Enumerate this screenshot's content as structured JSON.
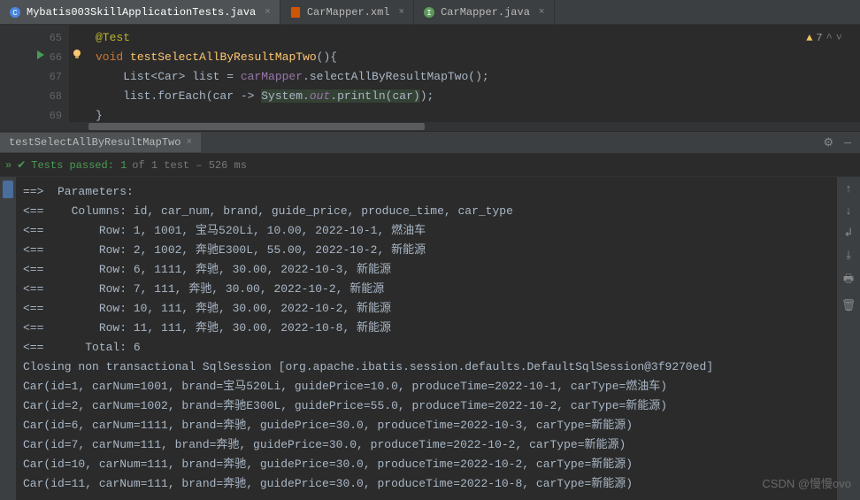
{
  "tabs": [
    {
      "label": "Mybatis003SkillApplicationTests.java",
      "iconColor": "#4a86e8",
      "active": true
    },
    {
      "label": "CarMapper.xml",
      "iconColor": "#d35400",
      "active": false
    },
    {
      "label": "CarMapper.java",
      "iconColor": "#4a86e8",
      "active": false
    }
  ],
  "warnings": {
    "count": "7"
  },
  "gutter": [
    "65",
    "66",
    "67",
    "68",
    "69"
  ],
  "code": {
    "l65": {
      "annotation": "@Test"
    },
    "l66": {
      "kw": "void",
      "method": "testSelectAllByResultMapTwo",
      "tail": "(){"
    },
    "l67": {
      "pre": "    List<Car> list = ",
      "field": "carMapper",
      "post": ".selectAllByResultMapTwo();"
    },
    "l68": {
      "pre": "    list.forEach(car -> ",
      "cls": "System",
      "dot1": ".",
      "out": "out",
      "dot2": ".",
      "m2": "println(car)",
      "post": ");"
    },
    "l69": {
      "brace": "}"
    }
  },
  "runTab": {
    "label": "testSelectAllByResultMapTwo"
  },
  "testStatus": {
    "passed": "Tests passed: 1",
    "info": " of 1 test – 526 ms"
  },
  "console": [
    "==>  Parameters: ",
    "<==    Columns: id, car_num, brand, guide_price, produce_time, car_type",
    "<==        Row: 1, 1001, 宝马520Li, 10.00, 2022-10-1, 燃油车",
    "<==        Row: 2, 1002, 奔驰E300L, 55.00, 2022-10-2, 新能源",
    "<==        Row: 6, 1111, 奔驰, 30.00, 2022-10-3, 新能源",
    "<==        Row: 7, 111, 奔驰, 30.00, 2022-10-2, 新能源",
    "<==        Row: 10, 111, 奔驰, 30.00, 2022-10-2, 新能源",
    "<==        Row: 11, 111, 奔驰, 30.00, 2022-10-8, 新能源",
    "<==      Total: 6",
    "Closing non transactional SqlSession [org.apache.ibatis.session.defaults.DefaultSqlSession@3f9270ed]",
    "Car(id=1, carNum=1001, brand=宝马520Li, guidePrice=10.0, produceTime=2022-10-1, carType=燃油车)",
    "Car(id=2, carNum=1002, brand=奔驰E300L, guidePrice=55.0, produceTime=2022-10-2, carType=新能源)",
    "Car(id=6, carNum=1111, brand=奔驰, guidePrice=30.0, produceTime=2022-10-3, carType=新能源)",
    "Car(id=7, carNum=111, brand=奔驰, guidePrice=30.0, produceTime=2022-10-2, carType=新能源)",
    "Car(id=10, carNum=111, brand=奔驰, guidePrice=30.0, produceTime=2022-10-2, carType=新能源)",
    "Car(id=11, carNum=111, brand=奔驰, guidePrice=30.0, produceTime=2022-10-8, carType=新能源)"
  ],
  "watermark": "CSDN @慢慢ovo"
}
